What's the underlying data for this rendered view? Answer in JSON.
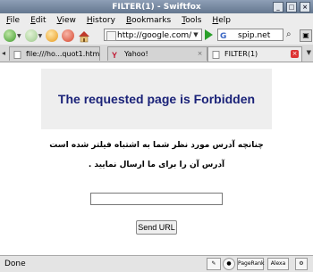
{
  "window": {
    "title": "FILTER(1) - Swiftfox",
    "minimize": "_",
    "maximize": "□",
    "close": "×"
  },
  "menu": [
    "File",
    "Edit",
    "View",
    "History",
    "Bookmarks",
    "Tools",
    "Help"
  ],
  "menu_underline": [
    "F",
    "E",
    "V",
    "H",
    "B",
    "T",
    "H"
  ],
  "toolbar": {
    "url": "http://google.com/",
    "search_value": "spip.net",
    "search_engine_letter": "G"
  },
  "tabs": [
    {
      "label": "file:///ho...quot1.html"
    },
    {
      "label": "Yahoo!"
    },
    {
      "label": "FILTER(1)"
    }
  ],
  "page": {
    "heading": "The requested page is Forbidden",
    "line1": "چنانچه آدرس مورد نظر شما به اشتباه فیلتر شده است",
    "line2": "آدرس آن را برای ما ارسال نمایید .",
    "input_value": "",
    "button": "Send URL"
  },
  "status": {
    "text": "Done",
    "pagerank": "PageRank",
    "alexa": "Alexa"
  },
  "colors": {
    "heading": "#1a2278",
    "box": "#eeeeee",
    "titlebar": "#7386a0"
  }
}
